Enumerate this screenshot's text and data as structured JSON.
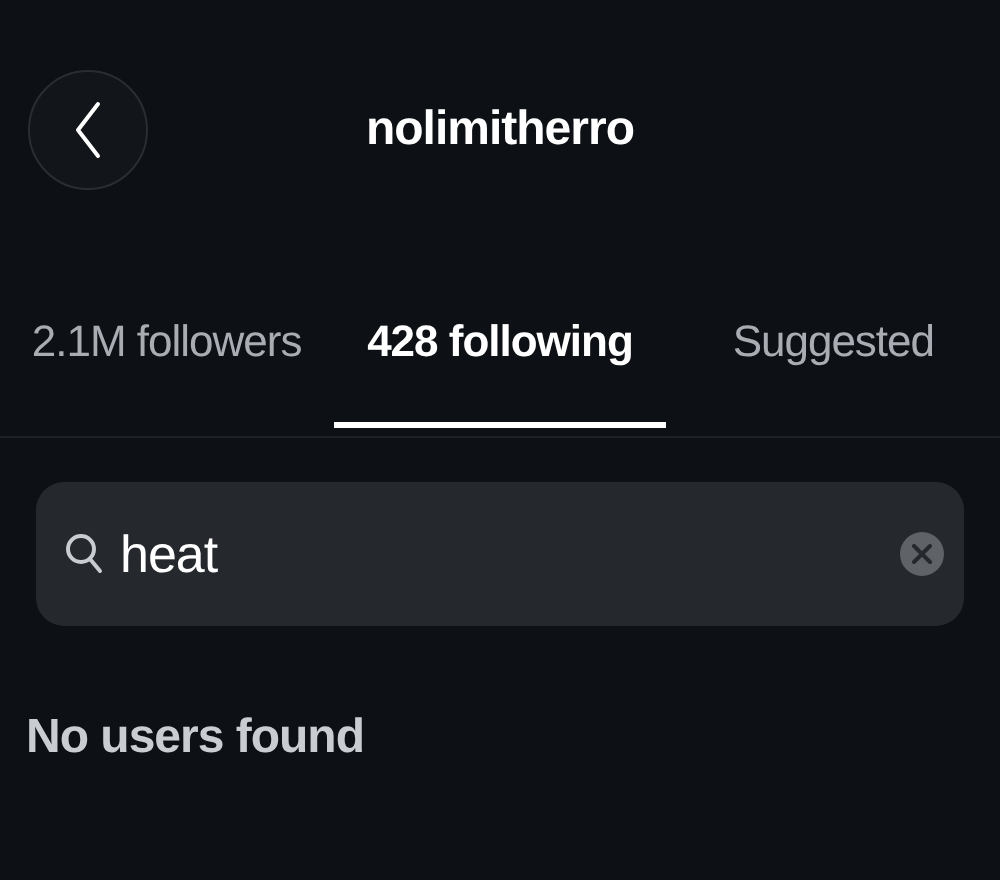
{
  "header": {
    "title": "nolimitherro"
  },
  "tabs": [
    {
      "label": "2.1M followers",
      "selected": false
    },
    {
      "label": "428 following",
      "selected": true
    },
    {
      "label": "Suggested",
      "selected": false
    }
  ],
  "search": {
    "value": "heat"
  },
  "empty_message": "No users found"
}
